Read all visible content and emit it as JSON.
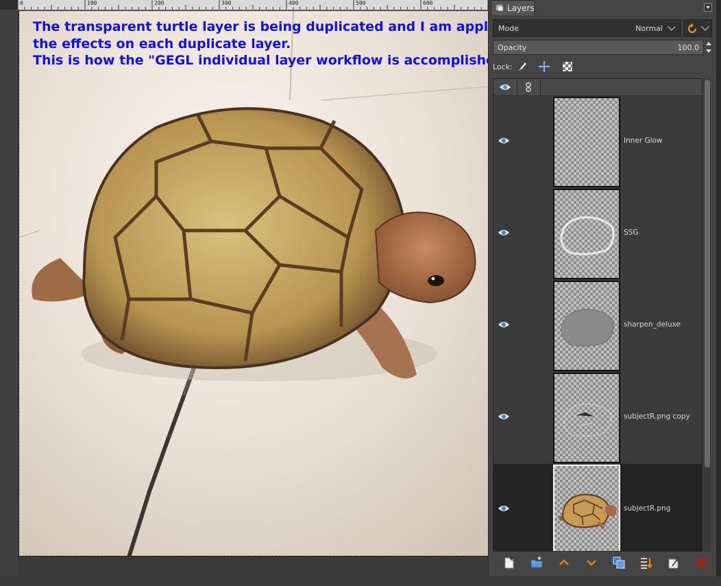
{
  "ruler": {
    "labels": [
      "0",
      "100",
      "200",
      "300",
      "400",
      "500",
      "600"
    ]
  },
  "annotation": {
    "lines": [
      "The transparent turtle layer is being duplicated and I am applying",
      "the effects on each duplicate layer.",
      "This is how the \"GEGL individual layer workflow is accomplished."
    ],
    "color": "#1010e8"
  },
  "dock": {
    "tab_label": "Layers",
    "mode_label": "Mode",
    "mode_value": "Normal",
    "opacity_label": "Opacity",
    "opacity_value": "100.0",
    "lock_label": "Lock:"
  },
  "layers": [
    {
      "name": "Inner Glow",
      "visible": true,
      "selected": false
    },
    {
      "name": "SSG",
      "visible": true,
      "selected": false
    },
    {
      "name": "sharpen_deluxe",
      "visible": true,
      "selected": false
    },
    {
      "name": "subjectR.png copy",
      "visible": true,
      "selected": false
    },
    {
      "name": "subjectR.png",
      "visible": true,
      "selected": true
    }
  ],
  "toolbar": {
    "icons": [
      "new-layer-icon",
      "new-layer-group-icon",
      "raise-layer-icon",
      "lower-layer-icon",
      "duplicate-layer-icon",
      "merge-down-icon",
      "layer-mask-icon",
      "delete-layer-icon"
    ]
  },
  "colors": {
    "accent": "#f08010",
    "delete": "#d01010",
    "eye": "#5a9bd8"
  }
}
